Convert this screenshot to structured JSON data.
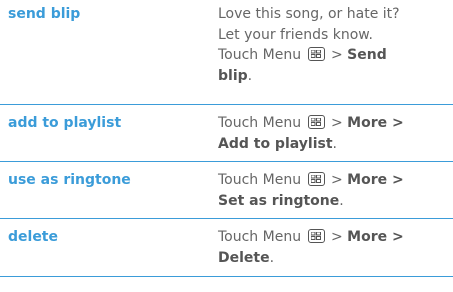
{
  "colors": {
    "accent": "#3b9cd9",
    "body_text": "#666666",
    "rule": "#3b9cd9"
  },
  "rows": [
    {
      "term": "send blip",
      "lines": [
        "Love this song, or hate it?",
        "Let your friends know."
      ],
      "prefix": "Touch Menu",
      "icon": "menu-key-icon",
      "sep": ">",
      "action_a": "Send",
      "action_b": "blip",
      "tail": "."
    },
    {
      "term": "add to playlist",
      "prefix": "Touch Menu",
      "icon": "menu-key-icon",
      "sep": ">",
      "action_a": "More >",
      "action_b": "Add to playlist",
      "tail": "."
    },
    {
      "term": "use as ringtone",
      "prefix": "Touch Menu",
      "icon": "menu-key-icon",
      "sep": ">",
      "action_a": "More >",
      "action_b": "Set as ringtone",
      "tail": "."
    },
    {
      "term": "delete",
      "prefix": "Touch Menu",
      "icon": "menu-key-icon",
      "sep": ">",
      "action_a": "More >",
      "action_b": "Delete",
      "tail": "."
    }
  ]
}
